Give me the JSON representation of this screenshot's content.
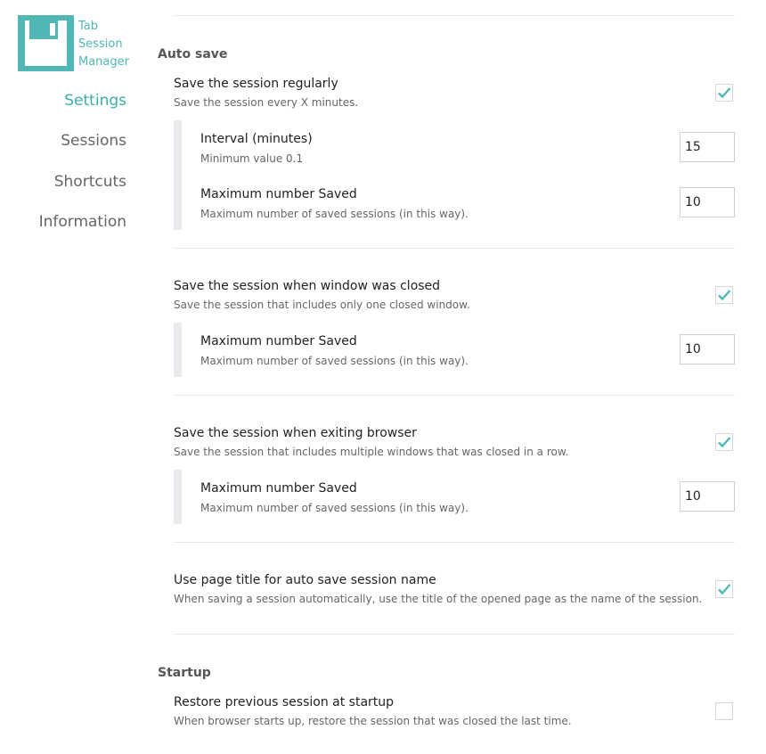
{
  "app": {
    "logo_lines": [
      "Tab",
      "Session",
      "Manager"
    ]
  },
  "sidebar": {
    "items": [
      {
        "label": "Settings",
        "active": true
      },
      {
        "label": "Sessions",
        "active": false
      },
      {
        "label": "Shortcuts",
        "active": false
      },
      {
        "label": "Information",
        "active": false
      }
    ]
  },
  "colors": {
    "accent": "#3aaea8",
    "check": "#4fb8b4",
    "logo": "#4fb8b4"
  },
  "auto_save": {
    "title": "Auto save",
    "regularly": {
      "label": "Save the session regularly",
      "description": "Save the session every X minutes.",
      "checked": true,
      "interval": {
        "label": "Interval (minutes)",
        "description": "Minimum value 0.1",
        "value": "15"
      },
      "max_saved": {
        "label": "Maximum number Saved",
        "description": "Maximum number of saved sessions (in this way).",
        "value": "10"
      }
    },
    "window_closed": {
      "label": "Save the session when window was closed",
      "description": "Save the session that includes only one closed window.",
      "checked": true,
      "max_saved": {
        "label": "Maximum number Saved",
        "description": "Maximum number of saved sessions (in this way).",
        "value": "10"
      }
    },
    "exiting_browser": {
      "label": "Save the session when exiting browser",
      "description": "Save the session that includes multiple windows that was closed in a row.",
      "checked": true,
      "max_saved": {
        "label": "Maximum number Saved",
        "description": "Maximum number of saved sessions (in this way).",
        "value": "10"
      }
    },
    "page_title": {
      "label": "Use page title for auto save session name",
      "description": "When saving a session automatically, use the title of the opened page as the name of the session.",
      "checked": true
    }
  },
  "startup": {
    "title": "Startup",
    "restore": {
      "label": "Restore previous session at startup",
      "description": "When browser starts up, restore the session that was closed the last time.",
      "checked": false
    }
  }
}
